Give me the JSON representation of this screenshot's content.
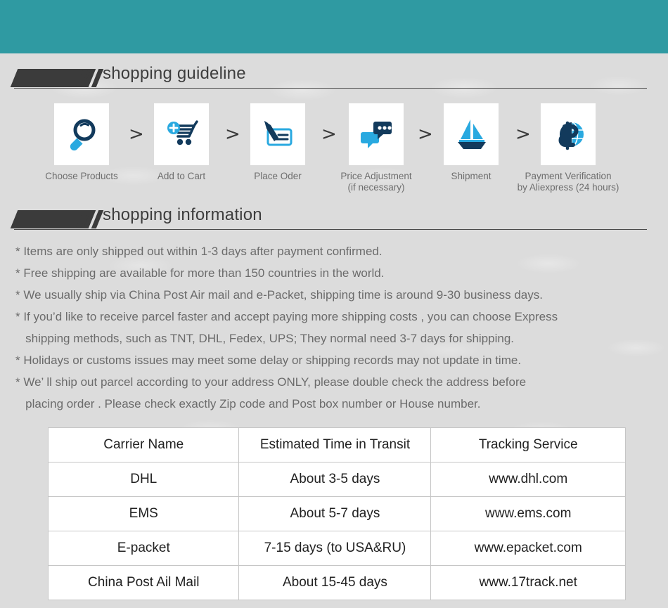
{
  "theme": {
    "banner_color": "#2f9aa2",
    "background_color": "#dcdcdc",
    "icon_dark": "#123a5c",
    "icon_blue": "#29a9e0",
    "text_gray": "#6b6b6b"
  },
  "guideline": {
    "heading": "shopping guideline",
    "steps": [
      {
        "icon": "magnifier-icon",
        "label": "Choose Products"
      },
      {
        "icon": "add-to-cart-icon",
        "label": "Add to Cart"
      },
      {
        "icon": "pen-check-icon",
        "label": "Place Oder"
      },
      {
        "icon": "chat-bubbles-icon",
        "label": "Price Adjustment\n(if necessary)"
      },
      {
        "icon": "sailboat-icon",
        "label": "Shipment"
      },
      {
        "icon": "dollar-globe-icon",
        "label": "Payment Verification\nby  Aliexpress (24 hours)"
      }
    ],
    "separator": ">"
  },
  "information": {
    "heading": "shopping information",
    "bullets": [
      "* Items are only shipped out within 1-3 days after payment confirmed.",
      "* Free shipping are available for more than 150 countries in the world.",
      "* We usually ship via China Post Air mail and e-Packet, shipping time is around 9-30 business days.",
      "* If you’d like to receive parcel faster and accept paying more shipping costs , you can choose Express",
      "   shipping methods, such as TNT, DHL, Fedex, UPS; They normal need 3-7 days for shipping.",
      "* Holidays or customs issues may meet some delay or shipping records may not update in time.",
      "* We’ ll ship out parcel according to your address ONLY, please double check the address before",
      "   placing order . Please check exactly Zip code and Post box number or House number."
    ]
  },
  "carrier_table": {
    "headers": [
      "Carrier Name",
      "Estimated Time in Transit",
      "Tracking Service"
    ],
    "rows": [
      [
        "DHL",
        "About 3-5 days",
        "www.dhl.com"
      ],
      [
        "EMS",
        "About 5-7 days",
        "www.ems.com"
      ],
      [
        "E-packet",
        "7-15 days (to USA&RU)",
        "www.epacket.com"
      ],
      [
        "China Post Ail Mail",
        "About 15-45 days",
        "www.17track.net"
      ]
    ]
  }
}
